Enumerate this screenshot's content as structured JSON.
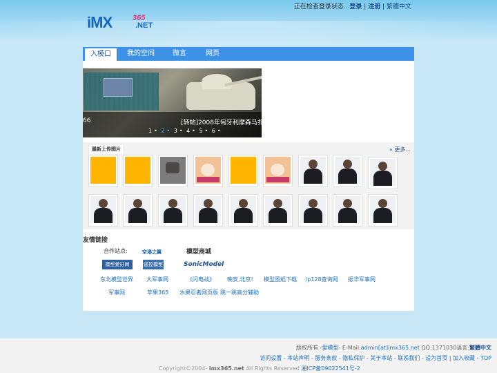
{
  "topbar": {
    "status": "正在检查登录状态...",
    "login": "登录",
    "sep1": " | ",
    "register": "注册",
    "sep2": " | ",
    "traditional": "繁體中文"
  },
  "logo": {
    "main": "iMX",
    "num": "365",
    "net": ".NET"
  },
  "tabs": [
    "入模口",
    "我的空间",
    "微言",
    "网页"
  ],
  "slideshow": {
    "caption": "[转帖]2008年匈牙利摩森马扎",
    "lead": "66",
    "dots": [
      "1",
      "2",
      "3",
      "4",
      "5",
      "6"
    ],
    "active": 2
  },
  "uploads": {
    "title": "最新上传图片",
    "more": "» 更多..."
  },
  "friends": {
    "title": "友情链接",
    "partner_label": "合作站点:",
    "logos": [
      "空港之翼",
      "模型商城",
      "模型爱好网",
      "遥控模型",
      "SonicModel"
    ],
    "row1": [
      "东北模型世界",
      "大军事网",
      "《闪电战》",
      "晚安,北京!",
      "模型图纸下载",
      "ip128查询网",
      "振华军事网"
    ],
    "row2": [
      "军事网",
      "苹果365",
      "水果忍者网页版",
      "跳一跳高分辅助"
    ]
  },
  "footer": {
    "line1": {
      "a": "版权所有 -",
      "b": "爱模型",
      "c": "- E-Mail:",
      "d": "admin[at]imx365.net",
      "e": " QQ:1371030语言:",
      "f": "繁體中文"
    },
    "line2": [
      "访问设置",
      "本站声明",
      "服务条款",
      "隐私保护",
      "关于本站",
      "联系我们",
      "设为首页",
      "加入收藏",
      "TOP"
    ],
    "copy": {
      "a": "Copyright©2004- ",
      "b": "imx365.net",
      "c": " All Rights Reserved ",
      "d": "湘ICP备09022541号-2"
    }
  }
}
